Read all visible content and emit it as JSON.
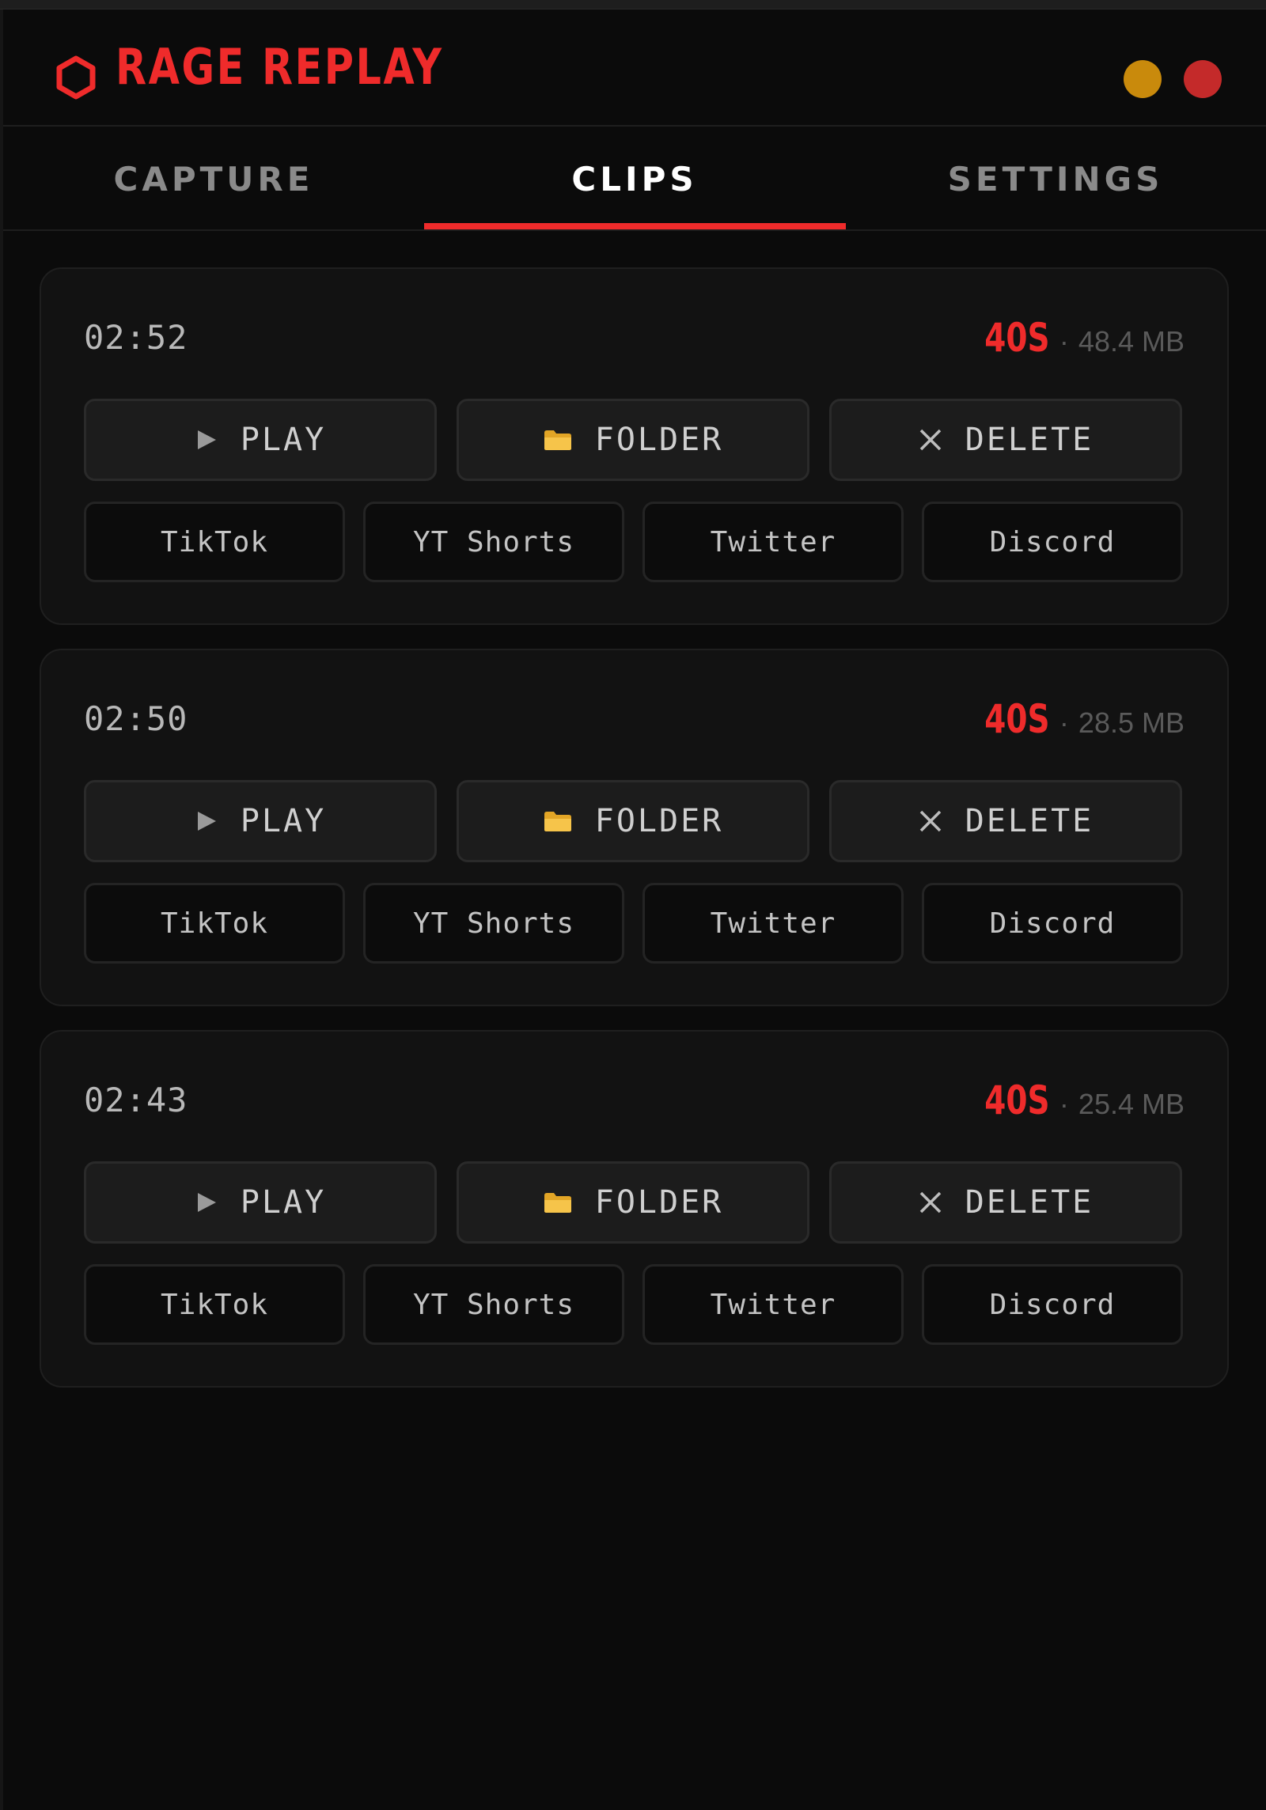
{
  "app": {
    "title": "RAGE REPLAY",
    "logo_icon": "hexagon-icon",
    "accent_color": "#ef2b2b",
    "window_controls": [
      {
        "name": "minimize",
        "color": "#c98a0c"
      },
      {
        "name": "close",
        "color": "#c42a2a"
      }
    ]
  },
  "tabs": [
    {
      "label": "CAPTURE",
      "active": false
    },
    {
      "label": "CLIPS",
      "active": true
    },
    {
      "label": "SETTINGS",
      "active": false
    }
  ],
  "actions": {
    "play_label": "PLAY",
    "play_icon": "play-icon",
    "folder_label": "FOLDER",
    "folder_icon": "folder-icon",
    "delete_label": "DELETE",
    "delete_icon": "close-icon"
  },
  "share_targets": [
    "TikTok",
    "YT Shorts",
    "Twitter",
    "Discord"
  ],
  "clips": [
    {
      "time": "02:52",
      "duration": "40S",
      "separator": "·",
      "size": "48.4 MB"
    },
    {
      "time": "02:50",
      "duration": "40S",
      "separator": "·",
      "size": "28.5 MB"
    },
    {
      "time": "02:43",
      "duration": "40S",
      "separator": "·",
      "size": "25.4 MB"
    }
  ]
}
